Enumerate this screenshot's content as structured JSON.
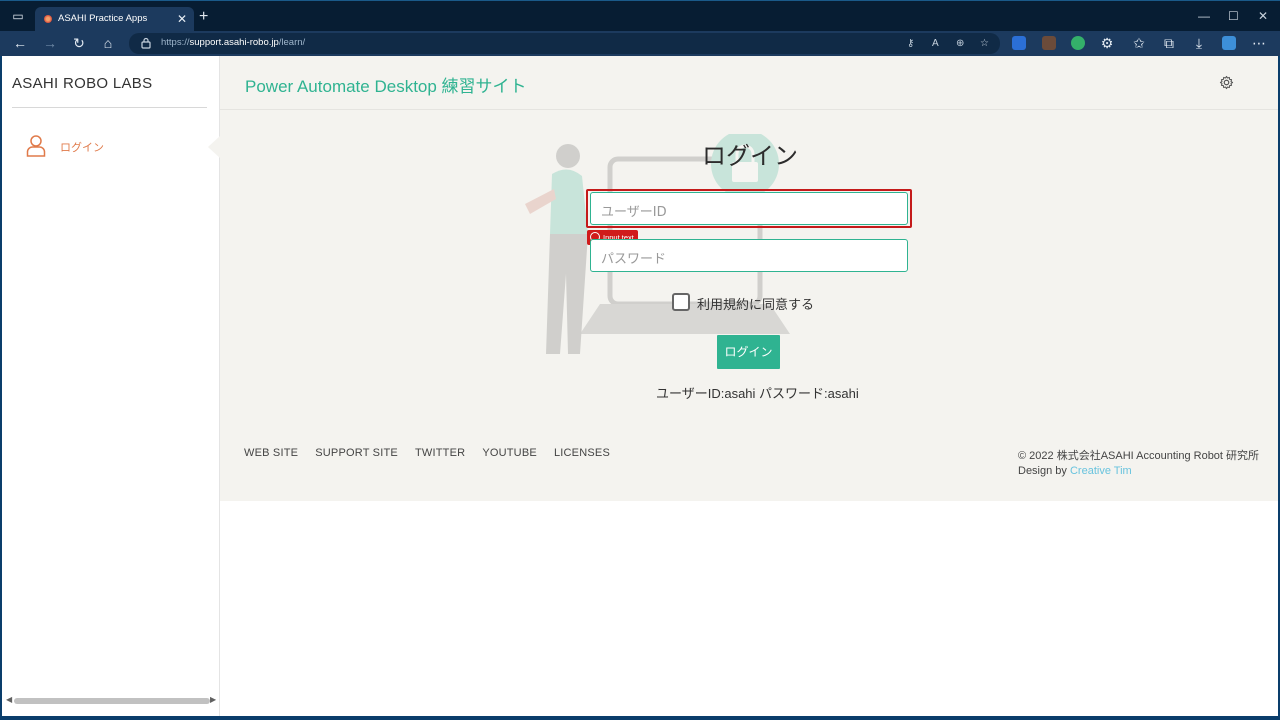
{
  "browser": {
    "tab_title": "ASAHI Practice Apps",
    "tab_close": "✕",
    "new_tab": "+",
    "url_prefix": "https://",
    "url_host": "support.asahi-robo.jp",
    "url_path": "/learn/",
    "window_controls": [
      "—",
      "☐",
      "✕"
    ]
  },
  "sidebar": {
    "brand": "ASAHI ROBO LABS",
    "items": [
      {
        "label": "ログイン",
        "icon": "person-icon"
      }
    ]
  },
  "header": {
    "site_title": "Power Automate Desktop 練習サイト"
  },
  "login": {
    "title": "ログイン",
    "user_id_placeholder": "ユーザーID",
    "password_placeholder": "パスワード",
    "agree_label": "利用規約に同意する",
    "submit_label": "ログイン",
    "hint": "ユーザーID:asahi パスワード:asahi",
    "highlight_tag": "Input text"
  },
  "footer": {
    "links": [
      "WEB SITE",
      "SUPPORT SITE",
      "TWITTER",
      "YOUTUBE",
      "LICENSES"
    ],
    "copyright": "© 2022 株式会社ASAHI Accounting Robot 研究所",
    "design_by": "Design by ",
    "design_link": "Creative Tim"
  },
  "colors": {
    "accent": "#2fb391",
    "sidebar_active": "#e07a4a",
    "highlight": "#c41a1a",
    "link": "#68c3de"
  }
}
